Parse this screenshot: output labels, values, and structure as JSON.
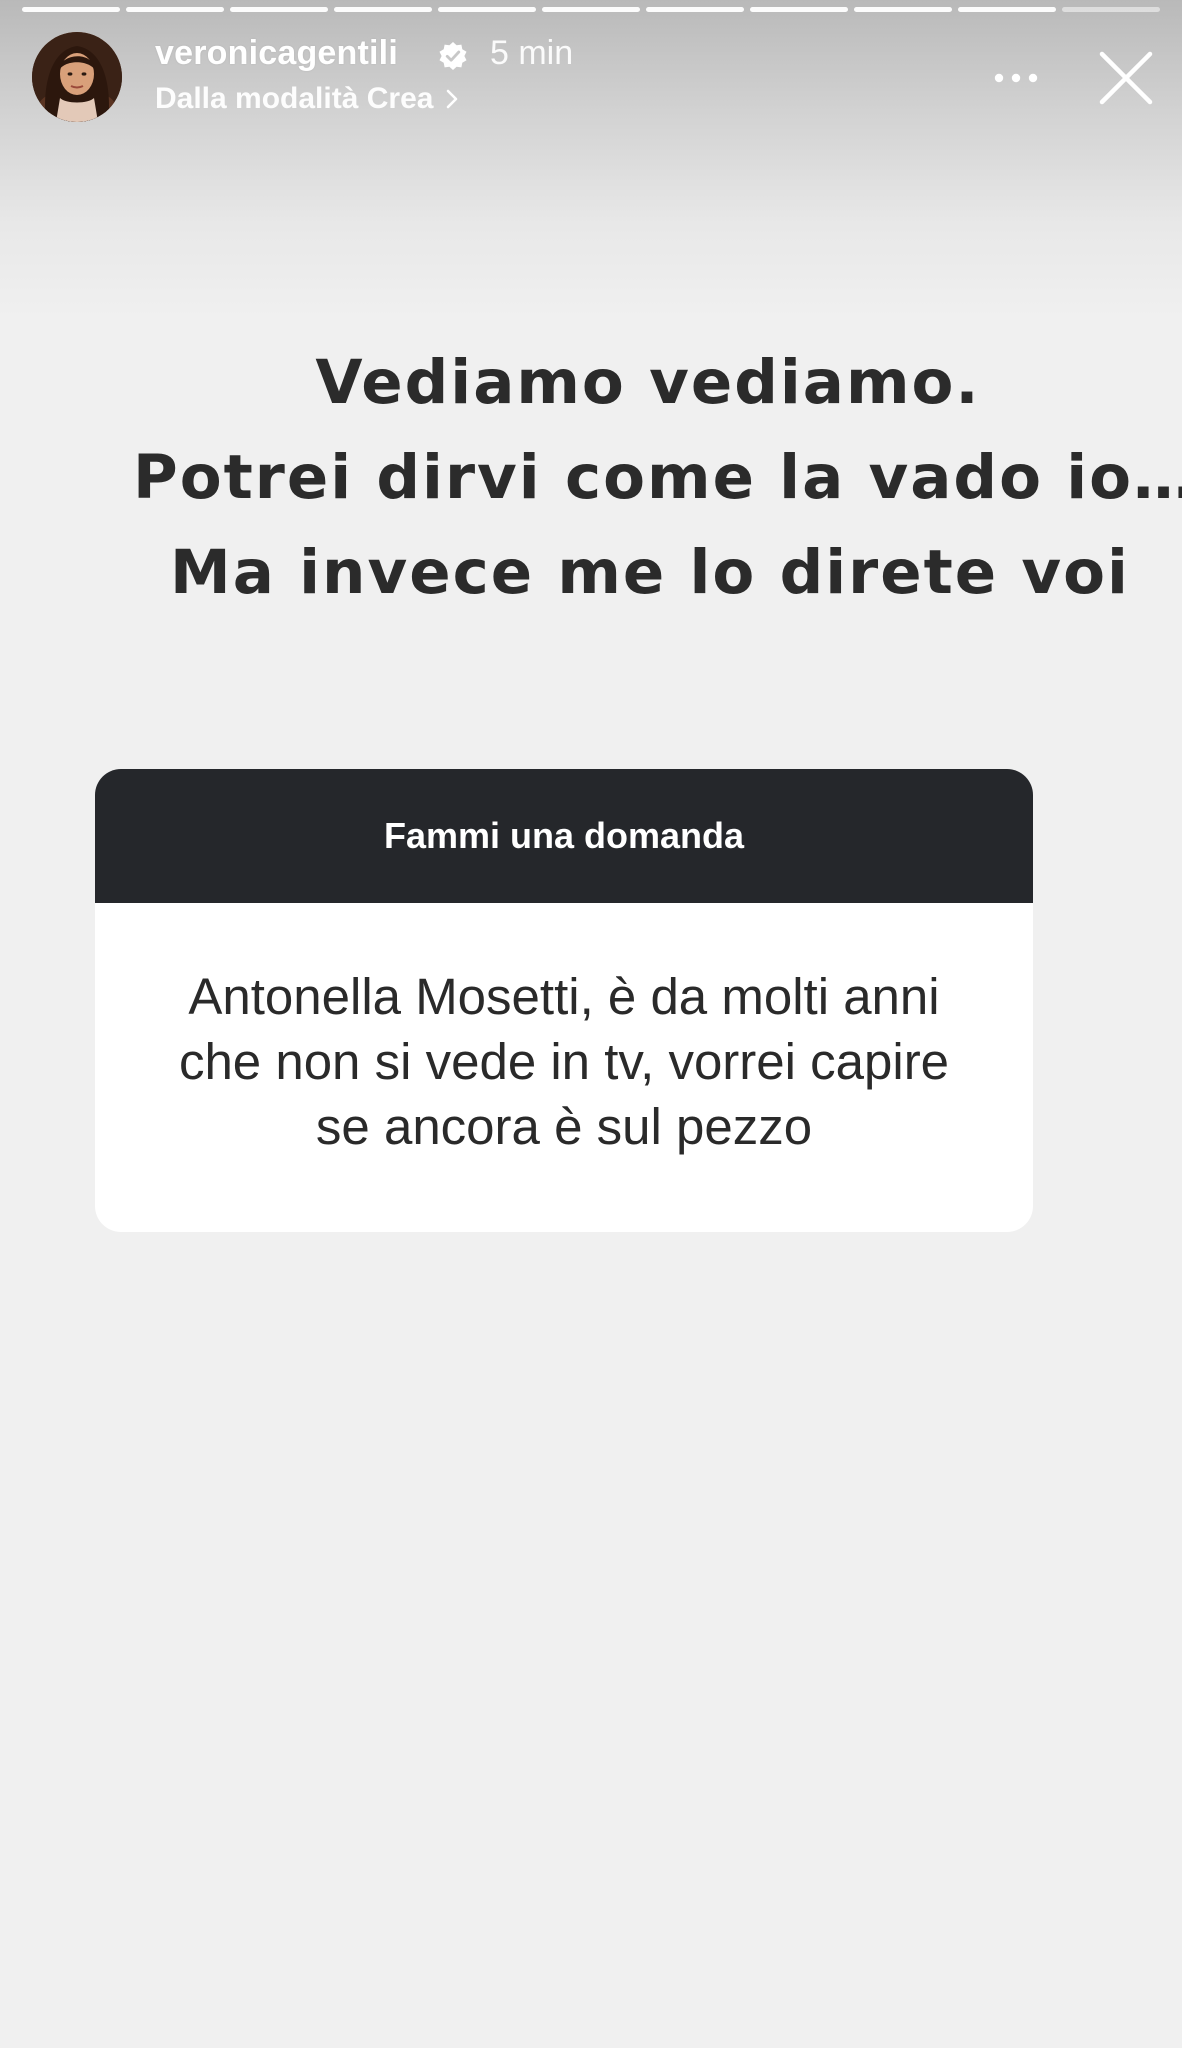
{
  "story_header": {
    "progress_segments": 11,
    "active_segment_index": 10,
    "username": "veronicagentili",
    "verified": true,
    "time_ago": "5 min",
    "subtitle": "Dalla modalità Crea"
  },
  "story_caption": {
    "lines": [
      "Vediamo vediamo.",
      "Potrei dirvi come la vado io…",
      "Ma invece me lo direte voi"
    ]
  },
  "question_sticker": {
    "header": "Fammi una domanda",
    "answer_lines": [
      "Antonella Mosetti, è da molti anni",
      "che non si vede in tv, vorrei capire",
      "se ancora è sul pezzo"
    ]
  },
  "icons": {
    "verified": "verified-badge-icon",
    "chevron": "chevron-right-icon",
    "more": "more-horizontal-icon",
    "close": "close-icon"
  },
  "colors": {
    "card_header_bg": "#25272b",
    "card_body_bg": "#ffffff",
    "page_bg": "#f0f0f0",
    "caption_text": "#2b2b2b"
  }
}
